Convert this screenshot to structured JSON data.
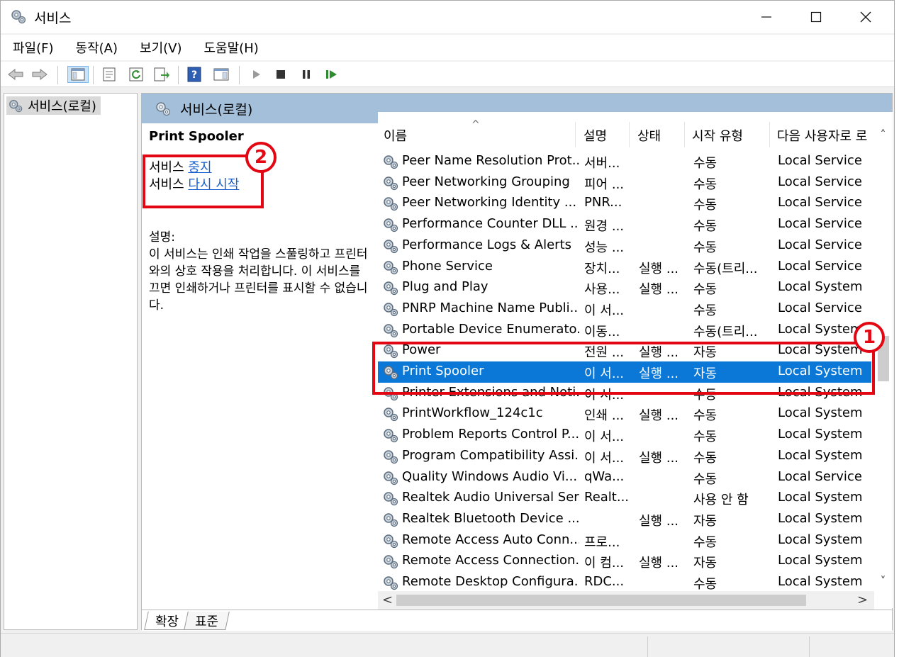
{
  "window": {
    "title": "서비스",
    "colors": {
      "header": "#a3bfd9",
      "selection": "#0b78d7",
      "annotation": "#e30613",
      "link": "#1a5fcc"
    }
  },
  "menu": [
    "파일(F)",
    "동작(A)",
    "보기(V)",
    "도움말(H)"
  ],
  "tree": {
    "root_label": "서비스(로컬)"
  },
  "main": {
    "header_title": "서비스(로컬)",
    "selected_service": "Print Spooler",
    "actions": {
      "prefix": "서비스",
      "stop_link": "중지",
      "restart_link": "다시 시작"
    },
    "desc_label": "설명:",
    "desc_body": "이 서비스는 인쇄 작업을 스풀링하고 프린터와의 상호 작용을 처리합니다. 이 서비스를 끄면 인쇄하거나 프린터를 표시할 수 없습니다.",
    "columns": [
      "이름",
      "설명",
      "상태",
      "시작 유형",
      "다음 사용자로 로"
    ],
    "rows": [
      [
        "Peer Name Resolution Prot...",
        "서버...",
        "",
        "수동",
        "Local Service"
      ],
      [
        "Peer Networking Grouping",
        "피어 ...",
        "",
        "수동",
        "Local Service"
      ],
      [
        "Peer Networking Identity ...",
        "PNR...",
        "",
        "수동",
        "Local Service"
      ],
      [
        "Performance Counter DLL ...",
        "원경 ...",
        "",
        "수동",
        "Local Service"
      ],
      [
        "Performance Logs & Alerts",
        "성능 ...",
        "",
        "수동",
        "Local Service"
      ],
      [
        "Phone Service",
        "장치...",
        "실행 ...",
        "수동(트리...",
        "Local Service"
      ],
      [
        "Plug and Play",
        "사용...",
        "실행 ...",
        "수동",
        "Local System"
      ],
      [
        "PNRP Machine Name Publi...",
        "이 서...",
        "",
        "수동",
        "Local Service"
      ],
      [
        "Portable Device Enumerato...",
        "이동...",
        "",
        "수동(트리...",
        "Local System"
      ],
      [
        "Power",
        "전원 ...",
        "실행 ...",
        "자동",
        "Local System"
      ],
      [
        "Print Spooler",
        "이 서...",
        "실행 ...",
        "자동",
        "Local System"
      ],
      [
        "Printer Extensions and Noti...",
        "이 서...",
        "",
        "수동",
        "Local System"
      ],
      [
        "PrintWorkflow_124c1c",
        "인쇄 ...",
        "실행 ...",
        "수동",
        "Local System"
      ],
      [
        "Problem Reports Control P...",
        "이 서...",
        "",
        "수동",
        "Local System"
      ],
      [
        "Program Compatibility Assi...",
        "이 서...",
        "실행 ...",
        "수동",
        "Local System"
      ],
      [
        "Quality Windows Audio Vi...",
        "qWa...",
        "",
        "수동",
        "Local Service"
      ],
      [
        "Realtek Audio Universal Ser...",
        "Realt...",
        "",
        "사용 안 함",
        "Local System"
      ],
      [
        "Realtek Bluetooth Device ...",
        "",
        "실행 ...",
        "자동",
        "Local System"
      ],
      [
        "Remote Access Auto Conn...",
        "프로...",
        "",
        "수동",
        "Local System"
      ],
      [
        "Remote Access Connection...",
        "이 컴...",
        "실행 ...",
        "자동",
        "Local System"
      ],
      [
        "Remote Desktop Configura...",
        "RDC...",
        "",
        "수동",
        "Local System"
      ]
    ],
    "selected_row_index": 10,
    "tabs": [
      "확장",
      "표준"
    ]
  },
  "annotations": [
    "1",
    "2"
  ],
  "icons": {
    "title": "services-gear-icon",
    "back": "arrow-left-icon",
    "forward": "arrow-right-icon",
    "row": "service-gear-icon"
  }
}
